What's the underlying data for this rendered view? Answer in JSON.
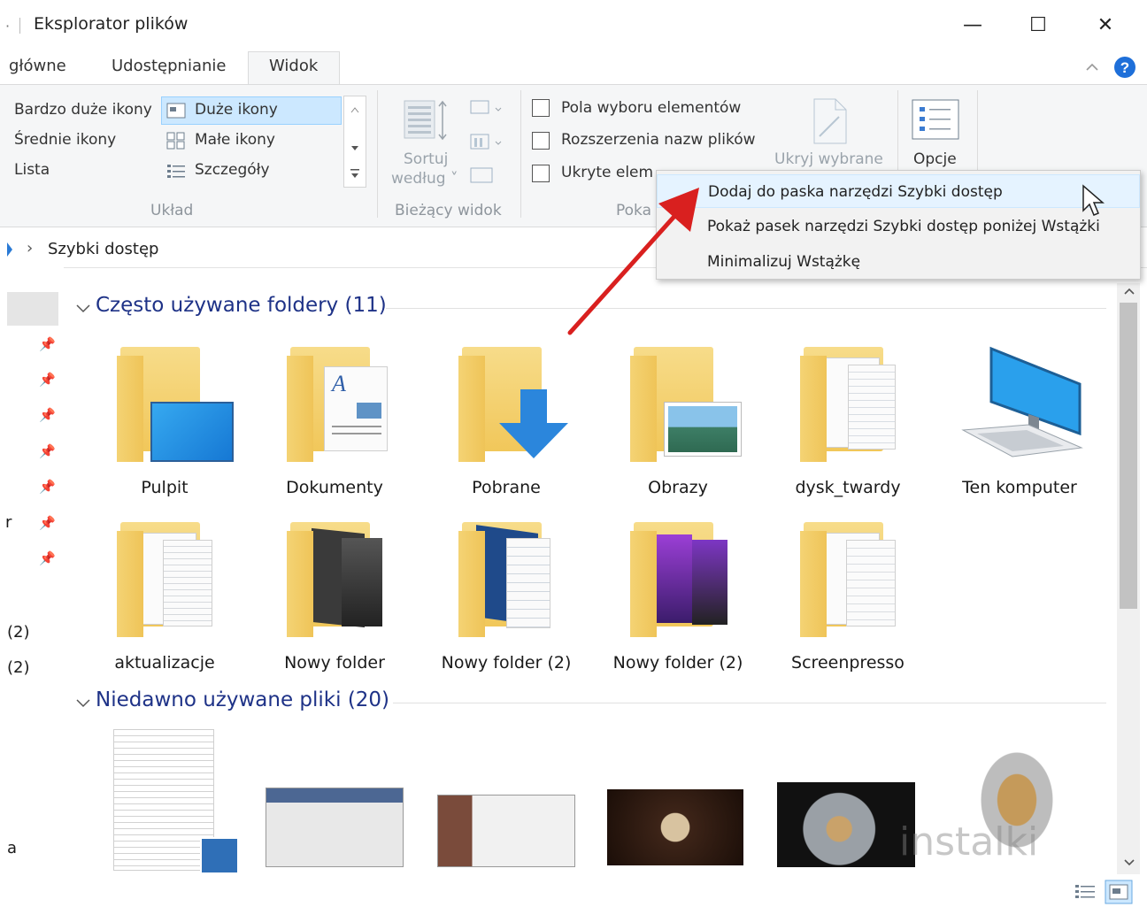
{
  "window": {
    "title": "Eksplorator plików",
    "minimize_glyph": "—",
    "maximize_glyph": "☐",
    "close_glyph": "✕"
  },
  "tabs": {
    "home": "główne",
    "share": "Udostępnianie",
    "view": "Widok"
  },
  "ribbon": {
    "layout": {
      "items": [
        "Bardzo duże ikony",
        "Duże ikony",
        "Średnie ikony",
        "Małe ikony",
        "Lista",
        "Szczegóły"
      ],
      "selected": "Duże ikony",
      "group_label": "Układ"
    },
    "current_view": {
      "sort_line1": "Sortuj",
      "sort_line2": "według ˅",
      "group_label": "Bieżący widok"
    },
    "show_hide": {
      "checkbox_items": "Pola wyboru elementów",
      "file_extensions": "Rozszerzenia nazw plików",
      "hidden_items": "Ukryte elem",
      "group_label": "Poka",
      "hide_selected": "Ukryj wybrane"
    },
    "options": {
      "label": "Opcje"
    }
  },
  "address": {
    "chevron": "›",
    "path": "Szybki dostęp"
  },
  "context_menu": {
    "items": [
      "Dodaj do paska narzędzi Szybki dostęp",
      "Pokaż pasek narzędzi Szybki dostęp poniżej Wstążki",
      "Minimalizuj Wstążkę"
    ]
  },
  "sidebar": {
    "fragments": [
      "r",
      "(2)",
      "(2)",
      "a"
    ]
  },
  "frequent": {
    "title": "Często używane foldery (11)",
    "items": [
      "Pulpit",
      "Dokumenty",
      "Pobrane",
      "Obrazy",
      "dysk_twardy",
      "Ten komputer",
      "aktualizacje",
      "Nowy folder",
      "Nowy folder (2)",
      "Nowy folder (2)",
      "Screenpresso"
    ]
  },
  "recent": {
    "title": "Niedawno używane pliki (20)"
  },
  "watermark": "instalki",
  "colors": {
    "accent": "#1e3287",
    "selection": "#cce8ff",
    "arrow": "#d9201f",
    "folder": "#f1c75a"
  }
}
